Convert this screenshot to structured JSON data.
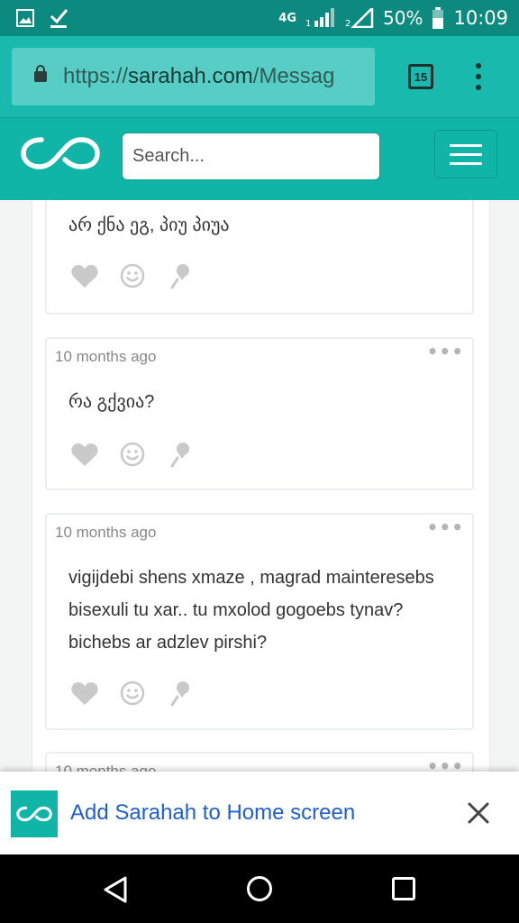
{
  "status_bar": {
    "network": "4G",
    "sim1": "1",
    "sim2": "2",
    "battery": "50%",
    "time": "10:09"
  },
  "browser": {
    "url_scheme": "https://",
    "url_host": "sarahah.com",
    "url_path": "/Messag",
    "tab_count": "15"
  },
  "header": {
    "search_placeholder": "Search..."
  },
  "messages": [
    {
      "time": "",
      "text": "არ ქნა ეგ, პიუ პიუა"
    },
    {
      "time": "10 months ago",
      "text": "რა გქვია?"
    },
    {
      "time": "10 months ago",
      "text": "vigijdebi shens xmaze , magrad mainteresebs bisexuli tu xar.. tu mxolod gogoebs tynav? bichebs ar adzlev pirshi?"
    },
    {
      "time": "10 months ago",
      "text": ""
    }
  ],
  "more_glyph": "•••",
  "a2hs": {
    "label": "Add Sarahah to Home screen"
  },
  "colors": {
    "brand": "#10b5a7",
    "link": "#1f5fd3"
  }
}
